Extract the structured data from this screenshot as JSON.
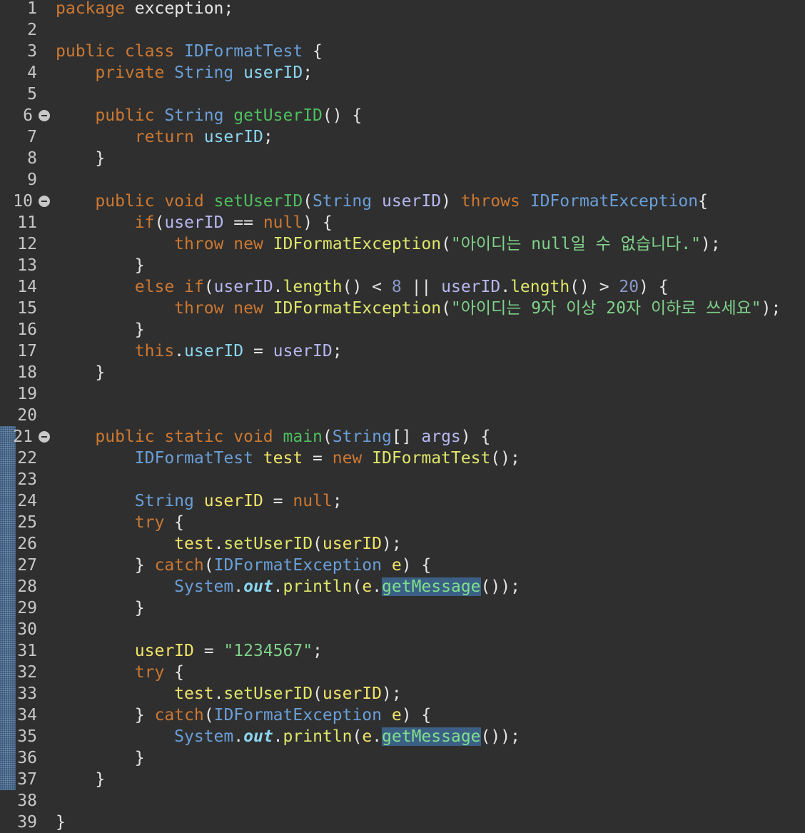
{
  "editor": {
    "language": "java",
    "colors": {
      "background": "#2f2f2f",
      "line_number": "#c7c7c7",
      "keyword": "#cc7832",
      "type": "#6a9fd8",
      "string": "#7fd18a",
      "highlight": "#3c5f86"
    },
    "lines": [
      {
        "n": "1",
        "fold": false,
        "tokens": [
          [
            "kw",
            "package "
          ],
          [
            "pl",
            "exception;"
          ]
        ]
      },
      {
        "n": "2",
        "fold": false,
        "tokens": []
      },
      {
        "n": "3",
        "fold": false,
        "tokens": [
          [
            "kw",
            "public class "
          ],
          [
            "ty",
            "IDFormatTest"
          ],
          [
            "pl",
            " {"
          ]
        ]
      },
      {
        "n": "4",
        "fold": false,
        "tokens": [
          [
            "pl",
            "    "
          ],
          [
            "kw",
            "private "
          ],
          [
            "ty",
            "String "
          ],
          [
            "fld",
            "userID"
          ],
          [
            "pl",
            ";"
          ]
        ]
      },
      {
        "n": "5",
        "fold": false,
        "tokens": []
      },
      {
        "n": "6",
        "fold": true,
        "tokens": [
          [
            "pl",
            "    "
          ],
          [
            "kw",
            "public "
          ],
          [
            "ty",
            "String "
          ],
          [
            "mdecl",
            "getUserID"
          ],
          [
            "pl",
            "() {"
          ]
        ]
      },
      {
        "n": "7",
        "fold": false,
        "tokens": [
          [
            "pl",
            "        "
          ],
          [
            "kw",
            "return "
          ],
          [
            "fld",
            "userID"
          ],
          [
            "pl",
            ";"
          ]
        ]
      },
      {
        "n": "8",
        "fold": false,
        "tokens": [
          [
            "pl",
            "    }"
          ]
        ]
      },
      {
        "n": "9",
        "fold": false,
        "tokens": []
      },
      {
        "n": "10",
        "fold": true,
        "tokens": [
          [
            "pl",
            "    "
          ],
          [
            "kw",
            "public void "
          ],
          [
            "mdecl",
            "setUserID"
          ],
          [
            "pl",
            "("
          ],
          [
            "ty",
            "String "
          ],
          [
            "prm",
            "userID"
          ],
          [
            "pl",
            ") "
          ],
          [
            "kw",
            "throws "
          ],
          [
            "ty",
            "IDFormatException"
          ],
          [
            "pl",
            "{"
          ]
        ]
      },
      {
        "n": "11",
        "fold": false,
        "tokens": [
          [
            "pl",
            "        "
          ],
          [
            "kw",
            "if"
          ],
          [
            "pl",
            "("
          ],
          [
            "prm",
            "userID"
          ],
          [
            "pl",
            " == "
          ],
          [
            "kw",
            "null"
          ],
          [
            "pl",
            ") {"
          ]
        ]
      },
      {
        "n": "12",
        "fold": false,
        "tokens": [
          [
            "pl",
            "            "
          ],
          [
            "kw",
            "throw new "
          ],
          [
            "yel",
            "IDFormatException"
          ],
          [
            "pl",
            "("
          ],
          [
            "str",
            "\"아이디는 null일 수 없습니다.\""
          ],
          [
            "pl",
            ");"
          ]
        ]
      },
      {
        "n": "13",
        "fold": false,
        "tokens": [
          [
            "pl",
            "        }"
          ]
        ]
      },
      {
        "n": "14",
        "fold": false,
        "tokens": [
          [
            "pl",
            "        "
          ],
          [
            "kw",
            "else if"
          ],
          [
            "pl",
            "("
          ],
          [
            "prm",
            "userID"
          ],
          [
            "pl",
            "."
          ],
          [
            "yel",
            "length"
          ],
          [
            "pl",
            "() < "
          ],
          [
            "num",
            "8"
          ],
          [
            "pl",
            " || "
          ],
          [
            "prm",
            "userID"
          ],
          [
            "pl",
            "."
          ],
          [
            "yel",
            "length"
          ],
          [
            "pl",
            "() > "
          ],
          [
            "num",
            "20"
          ],
          [
            "pl",
            ") {"
          ]
        ]
      },
      {
        "n": "15",
        "fold": false,
        "tokens": [
          [
            "pl",
            "            "
          ],
          [
            "kw",
            "throw new "
          ],
          [
            "yel",
            "IDFormatException"
          ],
          [
            "pl",
            "("
          ],
          [
            "str",
            "\"아이디는 9자 이상 20자 이하로 쓰세요\""
          ],
          [
            "pl",
            ");"
          ]
        ]
      },
      {
        "n": "16",
        "fold": false,
        "tokens": [
          [
            "pl",
            "        }"
          ]
        ]
      },
      {
        "n": "17",
        "fold": false,
        "tokens": [
          [
            "pl",
            "        "
          ],
          [
            "kw",
            "this"
          ],
          [
            "pl",
            "."
          ],
          [
            "fld",
            "userID"
          ],
          [
            "pl",
            " = "
          ],
          [
            "prm",
            "userID"
          ],
          [
            "pl",
            ";"
          ]
        ]
      },
      {
        "n": "18",
        "fold": false,
        "tokens": [
          [
            "pl",
            "    }"
          ]
        ]
      },
      {
        "n": "19",
        "fold": false,
        "tokens": []
      },
      {
        "n": "20",
        "fold": false,
        "tokens": []
      },
      {
        "n": "21",
        "fold": true,
        "tokens": [
          [
            "pl",
            "    "
          ],
          [
            "kw",
            "public static void "
          ],
          [
            "mdecl",
            "main"
          ],
          [
            "pl",
            "("
          ],
          [
            "ty",
            "String"
          ],
          [
            "pl",
            "[] "
          ],
          [
            "prm",
            "args"
          ],
          [
            "pl",
            ") {"
          ]
        ]
      },
      {
        "n": "22",
        "fold": false,
        "tokens": [
          [
            "pl",
            "        "
          ],
          [
            "ty",
            "IDFormatTest "
          ],
          [
            "loc",
            "test"
          ],
          [
            "pl",
            " = "
          ],
          [
            "kw",
            "new "
          ],
          [
            "yel",
            "IDFormatTest"
          ],
          [
            "pl",
            "();"
          ]
        ]
      },
      {
        "n": "23",
        "fold": false,
        "tokens": []
      },
      {
        "n": "24",
        "fold": false,
        "tokens": [
          [
            "pl",
            "        "
          ],
          [
            "ty",
            "String "
          ],
          [
            "loc",
            "userID"
          ],
          [
            "pl",
            " = "
          ],
          [
            "kw",
            "null"
          ],
          [
            "pl",
            ";"
          ]
        ]
      },
      {
        "n": "25",
        "fold": false,
        "tokens": [
          [
            "pl",
            "        "
          ],
          [
            "kw",
            "try"
          ],
          [
            "pl",
            " {"
          ]
        ]
      },
      {
        "n": "26",
        "fold": false,
        "tokens": [
          [
            "pl",
            "            "
          ],
          [
            "loc",
            "test"
          ],
          [
            "pl",
            "."
          ],
          [
            "yel",
            "setUserID"
          ],
          [
            "pl",
            "("
          ],
          [
            "loc",
            "userID"
          ],
          [
            "pl",
            ");"
          ]
        ]
      },
      {
        "n": "27",
        "fold": false,
        "tokens": [
          [
            "pl",
            "        } "
          ],
          [
            "kw",
            "catch"
          ],
          [
            "pl",
            "("
          ],
          [
            "ty",
            "IDFormatException "
          ],
          [
            "loc",
            "e"
          ],
          [
            "pl",
            ") {"
          ]
        ]
      },
      {
        "n": "28",
        "fold": false,
        "tokens": [
          [
            "pl",
            "            "
          ],
          [
            "ty",
            "System"
          ],
          [
            "pl",
            "."
          ],
          [
            "st",
            "out"
          ],
          [
            "pl",
            "."
          ],
          [
            "yel",
            "println"
          ],
          [
            "pl",
            "("
          ],
          [
            "loc",
            "e"
          ],
          [
            "pl",
            "."
          ],
          [
            "hl",
            "getMessage"
          ],
          [
            "pl",
            "());"
          ]
        ]
      },
      {
        "n": "29",
        "fold": false,
        "tokens": [
          [
            "pl",
            "        }"
          ]
        ]
      },
      {
        "n": "30",
        "fold": false,
        "tokens": []
      },
      {
        "n": "31",
        "fold": false,
        "tokens": [
          [
            "pl",
            "        "
          ],
          [
            "loc",
            "userID"
          ],
          [
            "pl",
            " = "
          ],
          [
            "str",
            "\"1234567\""
          ],
          [
            "pl",
            ";"
          ]
        ]
      },
      {
        "n": "32",
        "fold": false,
        "tokens": [
          [
            "pl",
            "        "
          ],
          [
            "kw",
            "try"
          ],
          [
            "pl",
            " {"
          ]
        ]
      },
      {
        "n": "33",
        "fold": false,
        "tokens": [
          [
            "pl",
            "            "
          ],
          [
            "loc",
            "test"
          ],
          [
            "pl",
            "."
          ],
          [
            "yel",
            "setUserID"
          ],
          [
            "pl",
            "("
          ],
          [
            "loc",
            "userID"
          ],
          [
            "pl",
            ");"
          ]
        ]
      },
      {
        "n": "34",
        "fold": false,
        "tokens": [
          [
            "pl",
            "        } "
          ],
          [
            "kw",
            "catch"
          ],
          [
            "pl",
            "("
          ],
          [
            "ty",
            "IDFormatException "
          ],
          [
            "loc",
            "e"
          ],
          [
            "pl",
            ") {"
          ]
        ]
      },
      {
        "n": "35",
        "fold": false,
        "tokens": [
          [
            "pl",
            "            "
          ],
          [
            "ty",
            "System"
          ],
          [
            "pl",
            "."
          ],
          [
            "st",
            "out"
          ],
          [
            "pl",
            "."
          ],
          [
            "yel",
            "println"
          ],
          [
            "pl",
            "("
          ],
          [
            "loc",
            "e"
          ],
          [
            "pl",
            "."
          ],
          [
            "hl",
            "getMessage"
          ],
          [
            "pl",
            "());"
          ]
        ]
      },
      {
        "n": "36",
        "fold": false,
        "tokens": [
          [
            "pl",
            "        }"
          ]
        ]
      },
      {
        "n": "37",
        "fold": false,
        "tokens": [
          [
            "pl",
            "    }"
          ]
        ]
      },
      {
        "n": "38",
        "fold": false,
        "tokens": []
      },
      {
        "n": "39",
        "fold": false,
        "tokens": [
          [
            "pl",
            "}"
          ]
        ]
      }
    ]
  }
}
